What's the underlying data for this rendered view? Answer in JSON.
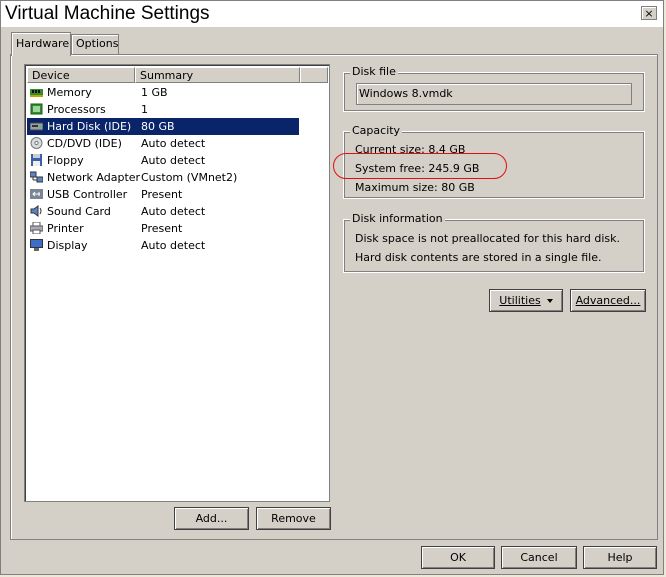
{
  "window": {
    "title": "Virtual Machine Settings",
    "close_glyph": "×"
  },
  "tabs": [
    {
      "label": "Hardware"
    },
    {
      "label": "Options"
    }
  ],
  "device_list": {
    "columns": [
      "Device",
      "Summary"
    ],
    "rows": [
      {
        "icon": "memory-icon",
        "device": "Memory",
        "summary": "1 GB"
      },
      {
        "icon": "processor-icon",
        "device": "Processors",
        "summary": "1"
      },
      {
        "icon": "hard-disk-icon",
        "device": "Hard Disk (IDE)",
        "summary": "80 GB",
        "selected": true
      },
      {
        "icon": "cd-dvd-icon",
        "device": "CD/DVD (IDE)",
        "summary": "Auto detect"
      },
      {
        "icon": "floppy-icon",
        "device": "Floppy",
        "summary": "Auto detect"
      },
      {
        "icon": "network-adapter-icon",
        "device": "Network Adapter",
        "summary": "Custom (VMnet2)"
      },
      {
        "icon": "usb-icon",
        "device": "USB Controller",
        "summary": "Present"
      },
      {
        "icon": "sound-card-icon",
        "device": "Sound Card",
        "summary": "Auto detect"
      },
      {
        "icon": "printer-icon",
        "device": "Printer",
        "summary": "Present"
      },
      {
        "icon": "display-icon",
        "device": "Display",
        "summary": "Auto detect"
      }
    ]
  },
  "list_buttons": {
    "add": "Add...",
    "remove": "Remove"
  },
  "disk_file": {
    "label": "Disk file",
    "value": "Windows 8.vmdk"
  },
  "capacity": {
    "label": "Capacity",
    "current_size": "Current size: 8.4 GB",
    "system_free": "System free: 245.9 GB",
    "maximum_size": "Maximum size: 80 GB",
    "highlight_color": "#e01010"
  },
  "disk_information": {
    "label": "Disk information",
    "line1": "Disk space is not preallocated for this hard disk.",
    "line2": "Hard disk contents are stored in a single file."
  },
  "disk_buttons": {
    "utilities": "Utilities",
    "advanced": "Advanced..."
  },
  "dialog_buttons": {
    "ok": "OK",
    "cancel": "Cancel",
    "help": "Help"
  },
  "colors": {
    "selection": "#0a246a",
    "face": "#d4d0c8"
  }
}
